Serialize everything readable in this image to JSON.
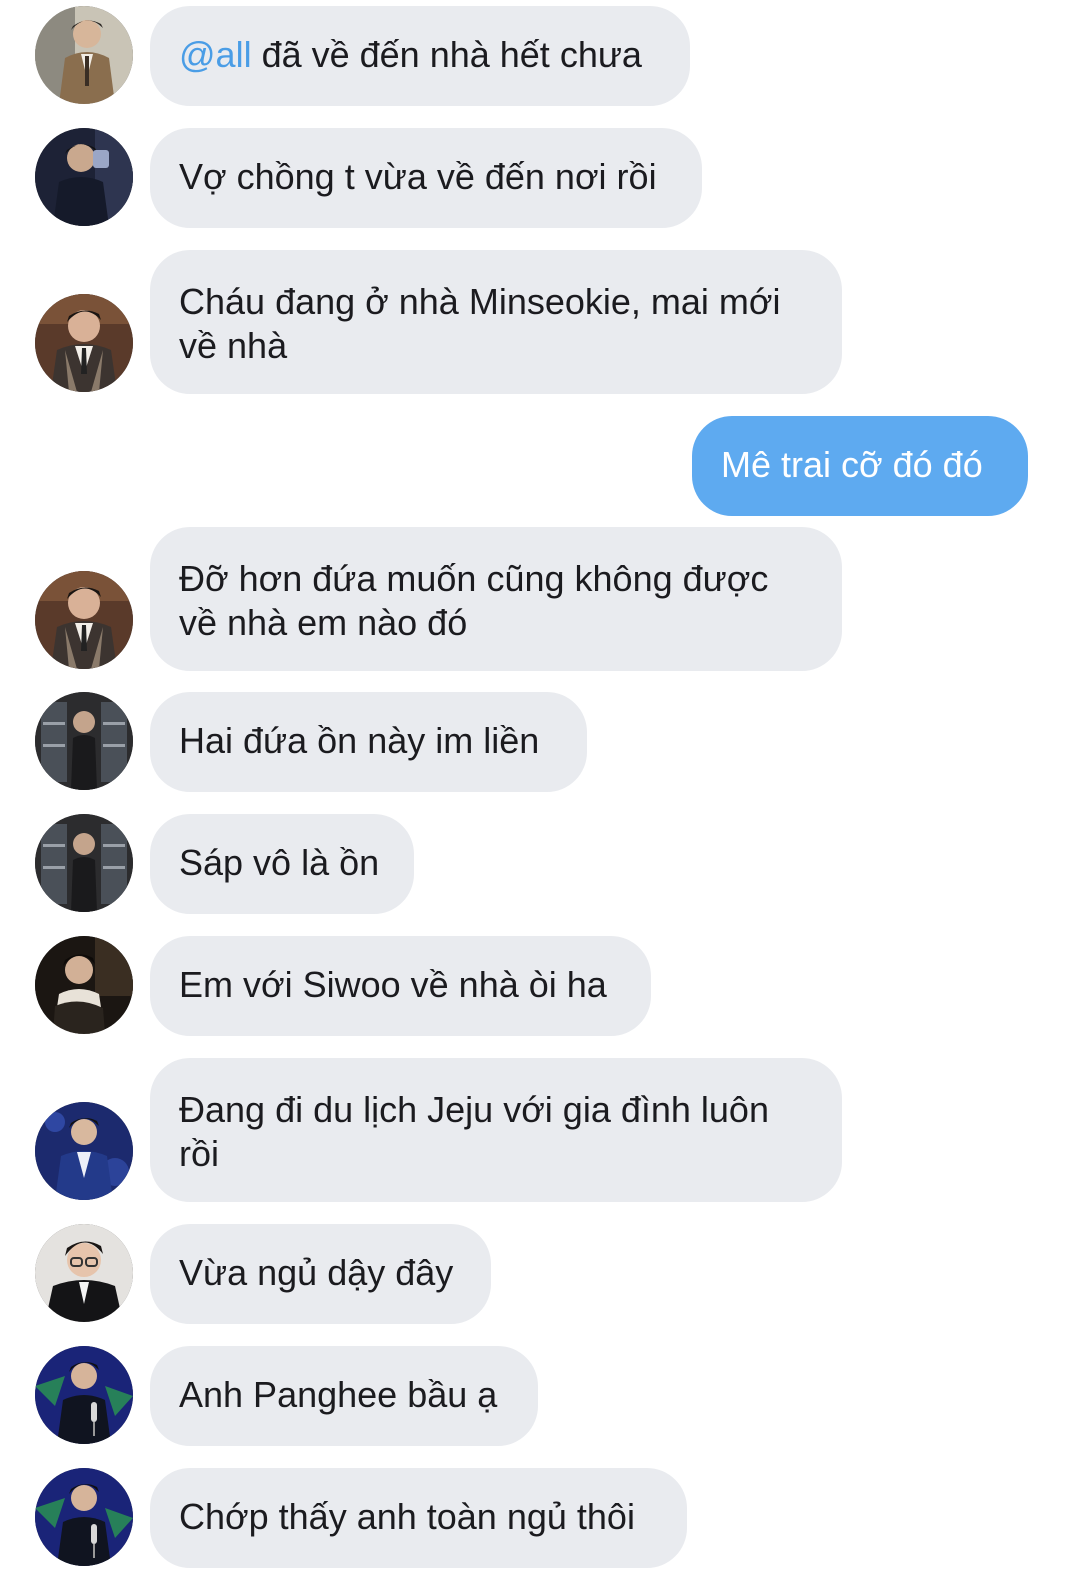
{
  "colors": {
    "incoming_bubble": "#e9ebef",
    "outgoing_bubble": "#5eaaf0",
    "mention": "#4a9de6",
    "text": "#1b1b1f"
  },
  "messages": [
    {
      "sender": "incoming",
      "avatar": "avatar-man-tan-suit-icon",
      "mention": "@all",
      "text": " đã về đến nhà hết chưa"
    },
    {
      "sender": "incoming",
      "avatar": "avatar-man-dark-suit-icon",
      "text": "Vợ chồng t vừa về đến nơi rồi"
    },
    {
      "sender": "incoming",
      "avatar": "avatar-man-vest-icon",
      "text": "Cháu đang ở nhà Minseokie, mai mới\nvề nhà"
    },
    {
      "sender": "outgoing",
      "text": "Mê trai cỡ đó đó"
    },
    {
      "sender": "incoming",
      "avatar": "avatar-man-vest-icon",
      "text": "Đỡ hơn đứa muốn cũng không được\nvề nhà em nào đó"
    },
    {
      "sender": "incoming",
      "avatar": "avatar-man-shelves-icon",
      "text": "Hai đứa ồn này im liền"
    },
    {
      "sender": "incoming",
      "avatar": "avatar-man-shelves-icon",
      "text": "Sáp vô là ồn"
    },
    {
      "sender": "incoming",
      "avatar": "avatar-man-dark-portrait-icon",
      "text": "Em với Siwoo về nhà òi ha"
    },
    {
      "sender": "incoming",
      "avatar": "avatar-man-blue-stage-icon",
      "text": "Đang đi du lịch Jeju với gia đình luôn\nrồi"
    },
    {
      "sender": "incoming",
      "avatar": "avatar-man-glasses-icon",
      "text": "Vừa ngủ dậy đây"
    },
    {
      "sender": "incoming",
      "avatar": "avatar-man-mic-stage-icon",
      "text": "Anh Panghee bầu ạ"
    },
    {
      "sender": "incoming",
      "avatar": "avatar-man-mic-stage-icon",
      "text": "Chớp thấy anh toàn ngủ thôi"
    }
  ]
}
